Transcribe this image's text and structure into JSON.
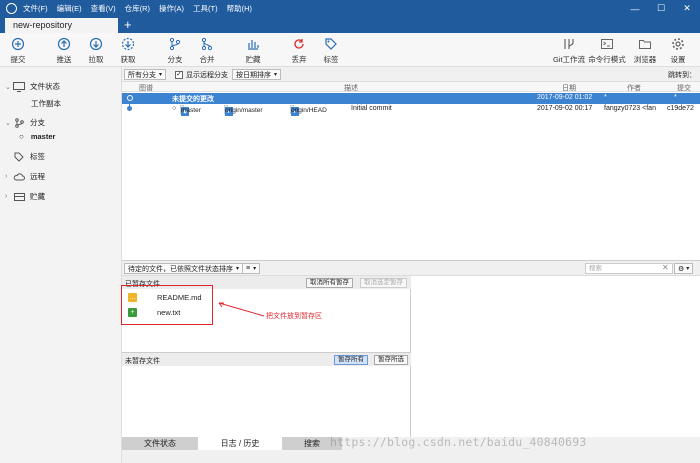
{
  "menu": [
    "文件(F)",
    "编辑(E)",
    "查看(V)",
    "仓库(R)",
    "操作(A)",
    "工具(T)",
    "帮助(H)"
  ],
  "tab": {
    "title": "new-repository",
    "add": "+"
  },
  "window_controls": {
    "min": "—",
    "max": "☐",
    "close": "✕"
  },
  "toolbar": {
    "commit": "提交",
    "push": "推送",
    "pull": "拉取",
    "fetch": "获取",
    "branch": "分支",
    "merge": "合并",
    "stash": "贮藏",
    "discard": "丢弃",
    "tag": "标签",
    "gitflow": "Git工作流",
    "terminal": "命令行模式",
    "explorer": "浏览器",
    "settings": "设置"
  },
  "sidebar": {
    "file_status": "文件状态",
    "working_copy": "工作副本",
    "branches": "分支",
    "master": "master",
    "tags": "标签",
    "remotes": "远程",
    "stashes": "贮藏"
  },
  "filters": {
    "branches": "所有分支",
    "show_remote": "显示远程分支",
    "sort": "按日期排序",
    "jump": "跳转到："
  },
  "columns": {
    "graph": "图谱",
    "description": "描述",
    "date": "日期",
    "author": "作者",
    "commit": "提交"
  },
  "commits": [
    {
      "description": "未提交的更改",
      "date": "2017-09-02 01:02",
      "author": "*",
      "hash": "*"
    },
    {
      "refs": [
        "master",
        "origin/master",
        "origin/HEAD"
      ],
      "description": "Initial commit",
      "date": "2017-09-02 00:17",
      "author": "fangzy0723 <fan",
      "hash": "c19de72"
    }
  ],
  "file_status": {
    "sort_label": "待定的文件，已依照文件状态排序",
    "search_placeholder": "搜索",
    "staged_title": "已暂存文件",
    "unstage_all": "取消所有暂存",
    "unstage_selected": "取消选定暂存",
    "unstaged_title": "未暂存文件",
    "stage_all": "暂存所有",
    "stage_selected": "暂存所选",
    "staged_files": [
      {
        "name": "README.md",
        "status": "modified",
        "color": "#f0b429"
      },
      {
        "name": "new.txt",
        "status": "added",
        "color": "#3a9b3a"
      }
    ]
  },
  "bottom_tabs": [
    "文件状态",
    "日志 / 历史",
    "搜索"
  ],
  "annotation": "把文件放到暂存区",
  "watermark": "https://blog.csdn.net/baidu_40840693",
  "colors": {
    "titlebar": "#205b9d",
    "selection": "#3c83d2",
    "annotation": "#e0242c"
  }
}
